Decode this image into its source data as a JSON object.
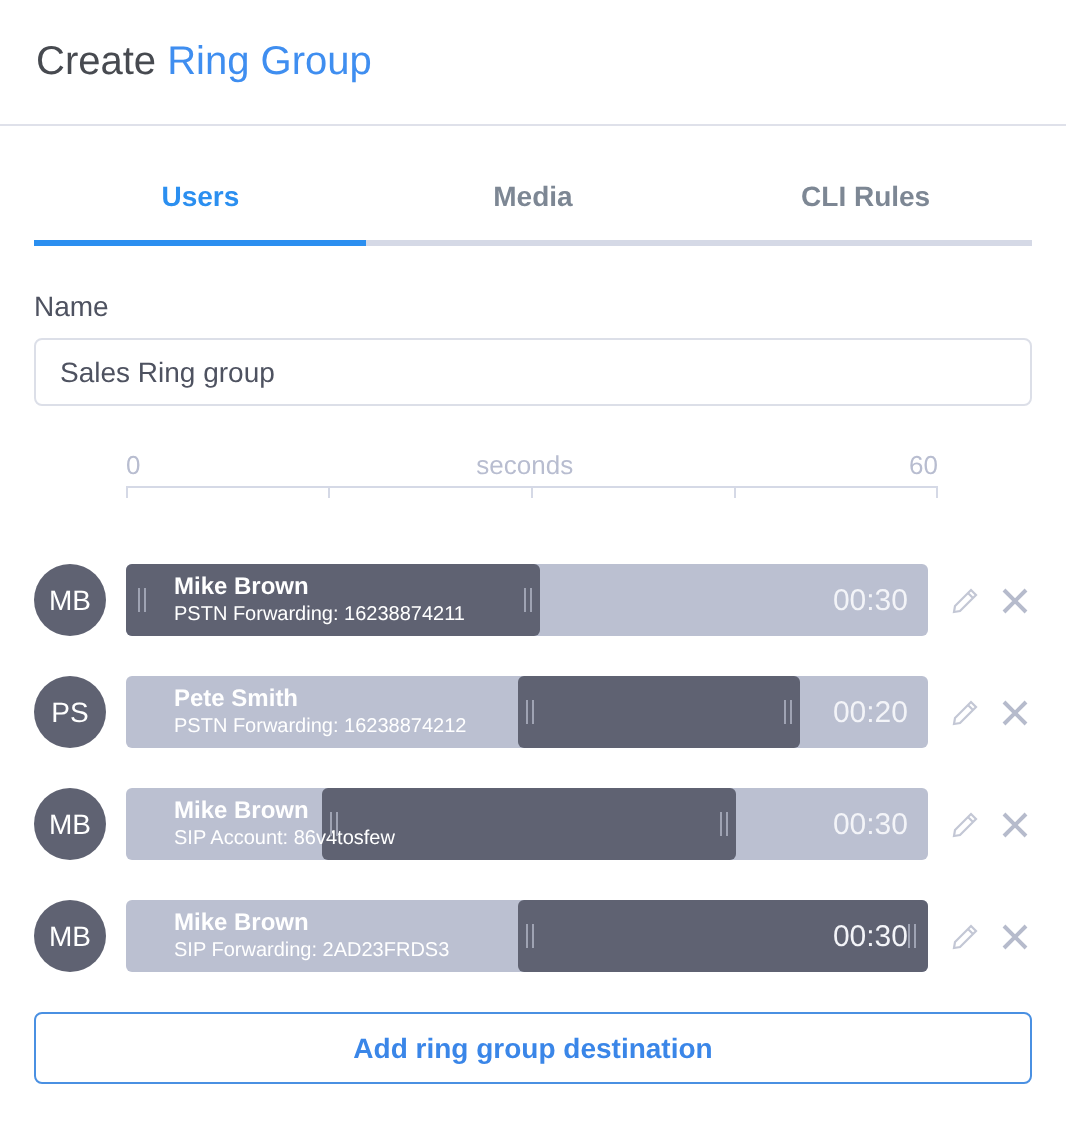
{
  "title": {
    "prefix": "Create",
    "highlight": "Ring Group"
  },
  "tabs": [
    {
      "label": "Users",
      "selected": true
    },
    {
      "label": "Media",
      "selected": false
    },
    {
      "label": "CLI Rules",
      "selected": false
    }
  ],
  "name_field": {
    "label": "Name",
    "value": "Sales Ring group"
  },
  "timeline": {
    "min_label": "0",
    "unit": "seconds",
    "max_label": "60"
  },
  "rows": [
    {
      "initials": "MB",
      "name": "Mike Brown",
      "detail": "PSTN Forwarding: 16238874211",
      "duration": "00:30",
      "start_handle": {
        "level": 0
      },
      "end_handle": {
        "level": 0.515
      }
    },
    {
      "initials": "PS",
      "name": "Pete Smith",
      "detail": "PSTN Forwarding: 16238874212",
      "duration": "00:20",
      "start_handle": {
        "level": 0.49
      },
      "end_handle": {
        "level": 0.84
      }
    },
    {
      "initials": "MB",
      "name": "Mike Brown",
      "detail": "SIP Account: 86v4tosfew",
      "duration": "00:30",
      "start_handle": {
        "level": 0.245
      },
      "end_handle": {
        "level": 0.76
      }
    },
    {
      "initials": "MB",
      "name": "Mike Brown",
      "detail": "SIP Forwarding: 2AD23FRDS3",
      "duration": "00:30",
      "start_handle": {
        "level": 0.49
      },
      "end_handle": {
        "level": 1
      }
    }
  ],
  "add_button": {
    "label": "Add ring group destination"
  }
}
